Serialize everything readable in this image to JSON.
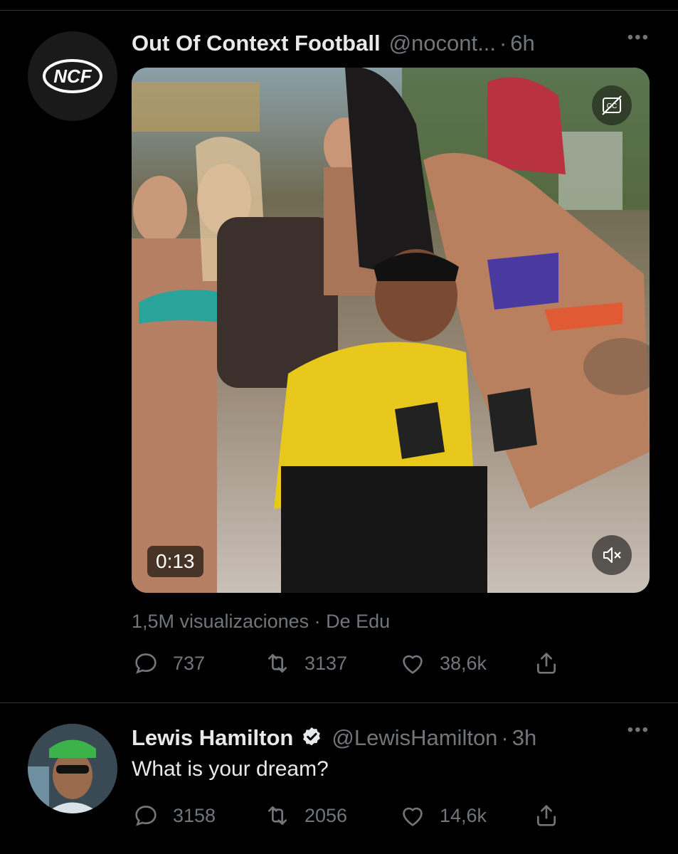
{
  "tweets": [
    {
      "author_name": "Out Of Context Football",
      "handle": "@nocont...",
      "separator": "·",
      "time": "6h",
      "avatar_text": "NCF",
      "more": "•••",
      "media": {
        "duration": "0:13",
        "cc_label": "CC"
      },
      "views": "1,5M visualizaciones · De Edu",
      "replies": "737",
      "retweets": "3137",
      "likes": "38,6k"
    },
    {
      "author_name": "Lewis Hamilton",
      "verified": true,
      "handle": "@LewisHamilton",
      "separator": "·",
      "time": "3h",
      "more": "•••",
      "text": "What is your dream?",
      "replies": "3158",
      "retweets": "2056",
      "likes": "14,6k"
    }
  ],
  "icons": {
    "reply": "reply-icon",
    "retweet": "retweet-icon",
    "like": "heart-icon",
    "share": "share-icon",
    "mute": "mute-icon",
    "cc": "closed-captions-icon",
    "verified": "verified-badge-icon"
  },
  "colors": {
    "background": "#000000",
    "primary_text": "#e7e9ea",
    "secondary_text": "#71767b",
    "divider": "#2f3336"
  }
}
